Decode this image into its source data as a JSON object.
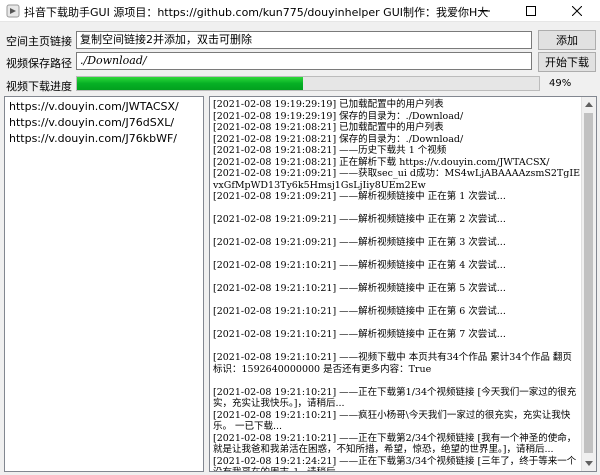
{
  "window": {
    "title": "抖音下载助手GUI 源项目：https://github.com/kun775/douyinhelper GUI制作：我爱你H大"
  },
  "form": {
    "home_label": "空间主页链接",
    "home_value": "复制空间链接2并添加，双击可删除",
    "add_label": "添加",
    "path_label": "视频保存路径",
    "path_value": "./Download/",
    "start_label": "开始下载",
    "progress_label": "视频下载进度",
    "progress_value": 0.49,
    "progress_text": "49%"
  },
  "urls": [
    "https://v.douyin.com/JWTACSX/",
    "https://v.douyin.com/J76dSXL/",
    "https://v.douyin.com/J76kbWF/"
  ],
  "log": [
    "[2021-02-08 19:19:29:19] 已加载配置中的用户列表",
    "[2021-02-08 19:19:29:19] 保存的目录为：./Download/",
    "[2021-02-08 19:21:08:21] 已加载配置中的用户列表",
    "[2021-02-08 19:21:08:21] 保存的目录为：./Download/",
    "[2021-02-08 19:21:08:21] ——历史下载共 1 个视频",
    "[2021-02-08 19:21:08:21] 正在解析下载 https://v.douyin.com/JWTACSX/",
    "[2021-02-08 19:21:09:21] ——获取sec_ui d成功：MS4wLjABAAAAzsmS2TgIEvxGfMpWD13Ty6k5Hmsj1GsLjIiy8UEm2Ew",
    "[2021-02-08 19:21:09:21] ——解析视频链接中 正在第 1 次尝试...",
    "",
    "[2021-02-08 19:21:09:21] ——解析视频链接中 正在第 2 次尝试...",
    "",
    "[2021-02-08 19:21:09:21] ——解析视频链接中 正在第 3 次尝试...",
    "",
    "[2021-02-08 19:21:10:21] ——解析视频链接中 正在第 4 次尝试...",
    "",
    "[2021-02-08 19:21:10:21] ——解析视频链接中 正在第 5 次尝试...",
    "",
    "[2021-02-08 19:21:10:21] ——解析视频链接中 正在第 6 次尝试...",
    "",
    "[2021-02-08 19:21:10:21] ——解析视频链接中 正在第 7 次尝试...",
    "",
    "[2021-02-08 19:21:10:21] ——视频下载中 本页共有34个作品 累计34个作品 翻页标识：1592640000000 是否还有更多内容：True",
    "",
    "[2021-02-08 19:21:10:21] ——正在下载第1/34个视频链接 [今天我们一家过的很充实，充实让我快乐。]，请稍后...",
    "[2021-02-08 19:21:10:21] ——疯狂小杨哥\\今天我们一家过的很充实，充实让我快乐。 一已下载...",
    "[2021-02-08 19:21:10:21] ——正在下载第2/34个视频链接 [我有一个神圣的使命，就是让我爸和我弟活在困惑，不知所措，希望，惊恐，绝望的世界里。]，请稍后...",
    "[2021-02-08 19:21:24:21] ——正在下载第3/34个视频链接 [三年了，终于等来一个没有我哥在的周末。]，请稍后..."
  ]
}
